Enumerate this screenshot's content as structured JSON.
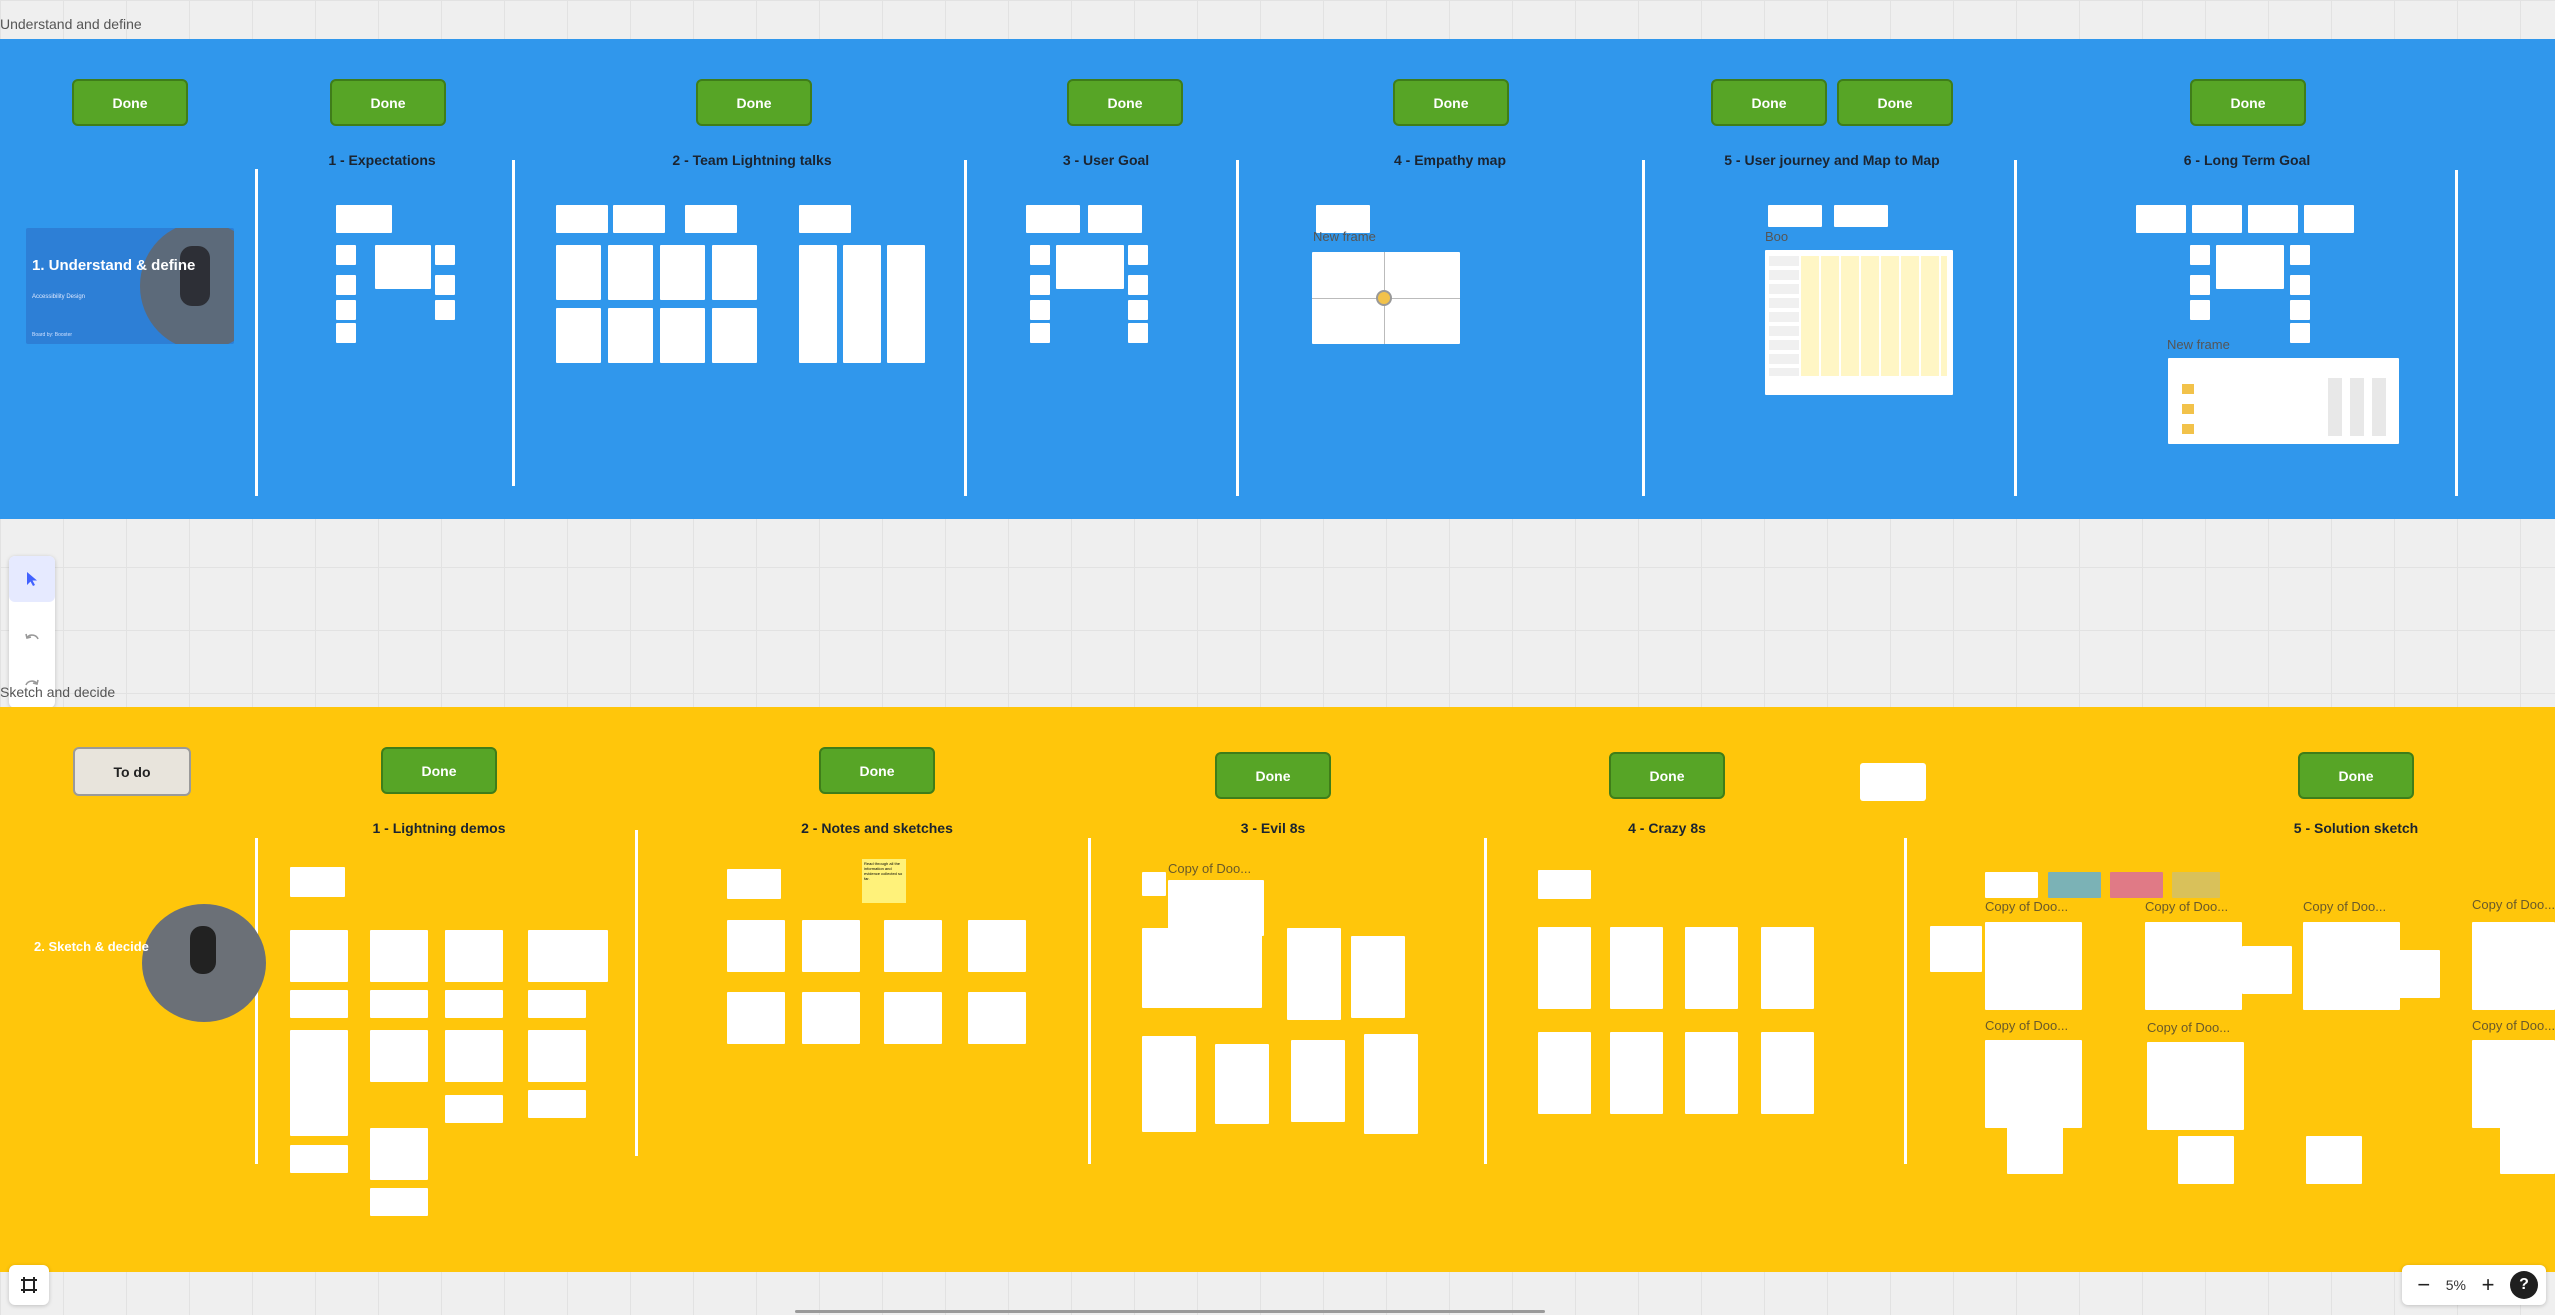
{
  "sections": {
    "understand": {
      "label": "Understand and define",
      "thumbnail": {
        "title": "1. Understand & define",
        "subtitle": "Accessibility Design",
        "footer": "Board by: Booster"
      },
      "columns": [
        {
          "title": "1 - Expectations",
          "status": [
            "Done"
          ]
        },
        {
          "title": "2 - Team Lightning talks",
          "status": [
            "Done"
          ]
        },
        {
          "title": "3 - User Goal",
          "status": [
            "Done"
          ]
        },
        {
          "title": "4 - Empathy map",
          "status": [
            "Done"
          ]
        },
        {
          "title": "5 - User journey and Map to Map",
          "status": [
            "Done",
            "Done"
          ]
        },
        {
          "title": "6 - Long Term Goal",
          "status": [
            "Done"
          ]
        }
      ],
      "intro_status": "Done",
      "labels": {
        "new_frame": "New frame",
        "boo": "Boo",
        "new_frame_2": "New frame"
      }
    },
    "sketch": {
      "label": "Sketch and decide",
      "thumbnail": {
        "title": "2. Sketch & decide"
      },
      "intro_status": "To do",
      "columns": [
        {
          "title": "1 - Lightning demos",
          "status": "Done"
        },
        {
          "title": "2 - Notes and sketches",
          "status": "Done"
        },
        {
          "title": "3 - Evil 8s",
          "status": "Done"
        },
        {
          "title": "4 - Crazy 8s",
          "status": "Done"
        },
        {
          "title": "5 - Solution sketch",
          "status": "Done"
        }
      ],
      "copy_label": "Copy of Doo...",
      "sticky_note": "Read through all the information and evidence collected so far."
    }
  },
  "toolbar": {
    "select_icon": "cursor-icon",
    "undo_icon": "undo-icon",
    "redo_icon": "redo-icon"
  },
  "zoom": {
    "level": "5%",
    "minus": "−",
    "plus": "+",
    "help": "?"
  },
  "colors": {
    "blue_section": "#3097ec",
    "yellow_section": "#ffc60b",
    "done": "#57a526",
    "todo": "#e8e4dc"
  }
}
